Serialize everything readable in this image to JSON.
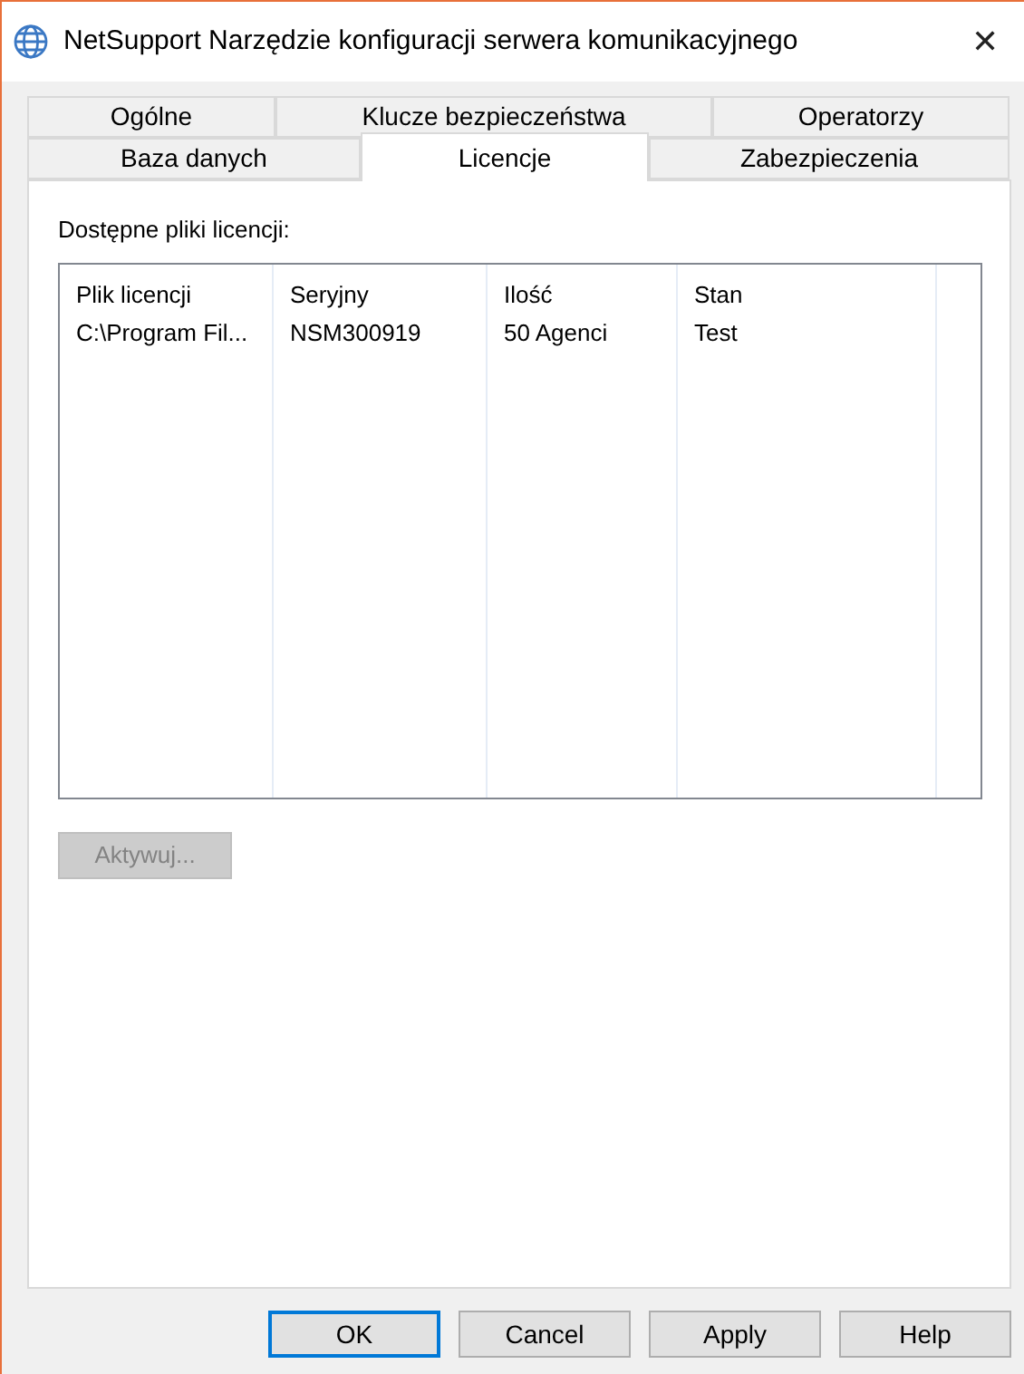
{
  "window": {
    "title": "NetSupport Narzędzie konfiguracji serwera komunikacyjnego",
    "close": "✕"
  },
  "tab_rows": [
    [
      {
        "label": "Ogólne",
        "selected": false
      },
      {
        "label": "Klucze bezpieczeństwa",
        "selected": false
      },
      {
        "label": "Operatorzy",
        "selected": false
      }
    ],
    [
      {
        "label": "Baza danych",
        "selected": false
      },
      {
        "label": "Licencje",
        "selected": true
      },
      {
        "label": "Zabezpieczenia",
        "selected": false
      }
    ]
  ],
  "group_label": "Dostępne pliki licencji:",
  "table": {
    "columns": [
      "Plik licencji",
      "Seryjny",
      "Ilość",
      "Stan"
    ],
    "rows": [
      [
        "C:\\Program Fil...",
        "NSM300919",
        "50 Agenci",
        "Test"
      ]
    ]
  },
  "activate_button": {
    "label": "Aktywuj...",
    "disabled": true
  },
  "buttons": [
    {
      "label": "OK",
      "default": true
    },
    {
      "label": "Cancel",
      "default": false
    },
    {
      "label": "Apply",
      "default": false
    },
    {
      "label": "Help",
      "default": false
    }
  ]
}
